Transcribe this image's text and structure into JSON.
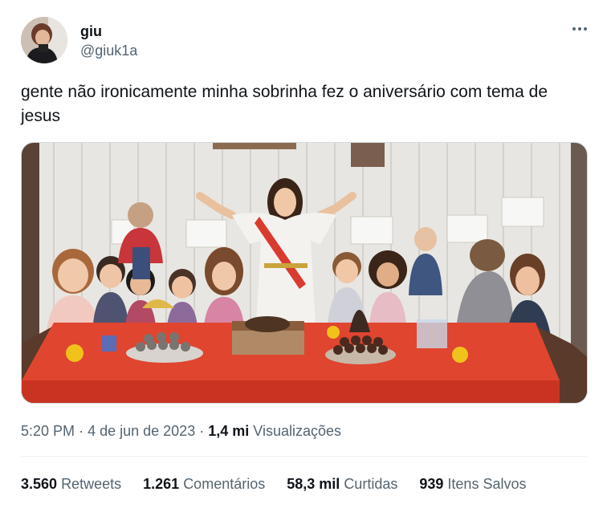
{
  "author": {
    "display_name": "giu",
    "handle": "@giuk1a"
  },
  "tweet": {
    "text": "gente não ironicamente minha sobrinha fez o aniversário com tema de jesus"
  },
  "meta": {
    "time": "5:20 PM",
    "separator": "·",
    "date": "4 de jun de 2023",
    "views_count": "1,4 mi",
    "views_label": "Visualizações"
  },
  "stats": [
    {
      "count": "3.560",
      "label": "Retweets"
    },
    {
      "count": "1.261",
      "label": "Comentários"
    },
    {
      "count": "58,3 mil",
      "label": "Curtidas"
    },
    {
      "count": "939",
      "label": "Itens Salvos"
    }
  ],
  "icons": {
    "more": "more-horizontal-icon"
  },
  "colors": {
    "text_primary": "#0f1419",
    "text_secondary": "#536471",
    "tablecloth": "#e0452f",
    "wall": "#e9e7e3"
  }
}
